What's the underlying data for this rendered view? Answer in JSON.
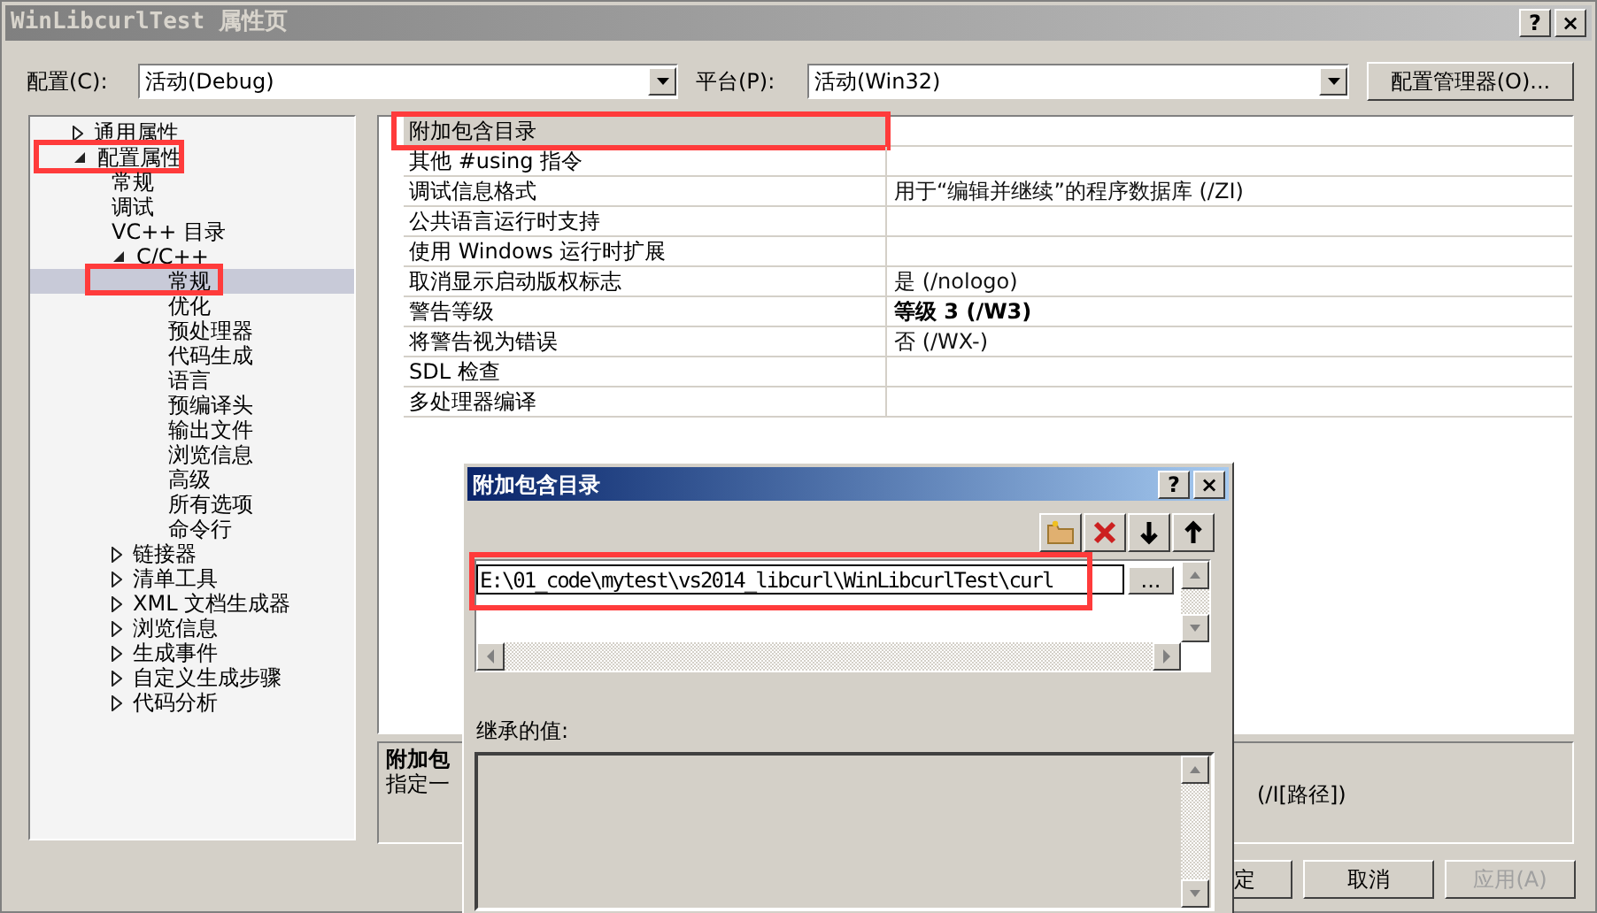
{
  "window": {
    "title": "WinLibcurlTest 属性页",
    "buttons": [
      "?",
      "×"
    ]
  },
  "config": {
    "label": "配置(C):",
    "value": "活动(Debug)"
  },
  "platform": {
    "label": "平台(P):",
    "value": "活动(Win32)"
  },
  "config_manager_button": "配置管理器(O)...",
  "tree": [
    {
      "label": "通用属性",
      "expanded": false,
      "selected": false,
      "highlighted": false
    },
    {
      "label": "配置属性",
      "expanded": true,
      "selected": false,
      "highlighted": true,
      "children": [
        {
          "label": "常规",
          "selected": false,
          "highlighted": false
        },
        {
          "label": "调试",
          "selected": false,
          "highlighted": false
        },
        {
          "label": "VC++ 目录",
          "selected": false,
          "highlighted": false
        },
        {
          "label": "C/C++",
          "expanded": true,
          "selected": false,
          "highlighted": false,
          "children": [
            {
              "label": "常规",
              "selected": true,
              "highlighted": true
            },
            {
              "label": "优化",
              "selected": false,
              "highlighted": false
            },
            {
              "label": "预处理器",
              "selected": false,
              "highlighted": false
            },
            {
              "label": "代码生成",
              "selected": false,
              "highlighted": false
            },
            {
              "label": "语言",
              "selected": false,
              "highlighted": false
            },
            {
              "label": "预编译头",
              "selected": false,
              "highlighted": false
            },
            {
              "label": "输出文件",
              "selected": false,
              "highlighted": false
            },
            {
              "label": "浏览信息",
              "selected": false,
              "highlighted": false
            },
            {
              "label": "高级",
              "selected": false,
              "highlighted": false
            },
            {
              "label": "所有选项",
              "selected": false,
              "highlighted": false
            },
            {
              "label": "命令行",
              "selected": false,
              "highlighted": false
            }
          ]
        },
        {
          "label": "链接器",
          "expanded": false,
          "selected": false,
          "highlighted": false
        },
        {
          "label": "清单工具",
          "expanded": false,
          "selected": false,
          "highlighted": false
        },
        {
          "label": "XML 文档生成器",
          "expanded": false,
          "selected": false,
          "highlighted": false
        },
        {
          "label": "浏览信息",
          "expanded": false,
          "selected": false,
          "highlighted": false
        },
        {
          "label": "生成事件",
          "expanded": false,
          "selected": false,
          "highlighted": false
        },
        {
          "label": "自定义生成步骤",
          "expanded": false,
          "selected": false,
          "highlighted": false
        },
        {
          "label": "代码分析",
          "expanded": false,
          "selected": false,
          "highlighted": false
        }
      ]
    }
  ],
  "properties": [
    {
      "name": "附加包含目录",
      "selected": true,
      "highlighted": true
    },
    {
      "name": "其他 #using 指令",
      "selected": false,
      "highlighted": false
    },
    {
      "name": "调试信息格式",
      "value": "用于“编辑并继续”的程序数据库 (/ZI)",
      "selected": false,
      "highlighted": false,
      "modified": false
    },
    {
      "name": "公共语言运行时支持",
      "selected": false,
      "highlighted": false
    },
    {
      "name": "使用 Windows 运行时扩展",
      "selected": false,
      "highlighted": false
    },
    {
      "name": "取消显示启动版权标志",
      "value": "是 (/nologo)",
      "selected": false,
      "highlighted": false,
      "modified": false
    },
    {
      "name": "警告等级",
      "value": "等级 3 (/W3)",
      "selected": false,
      "highlighted": false,
      "modified": true
    },
    {
      "name": "将警告视为错误",
      "value": "否 (/WX-)",
      "selected": false,
      "highlighted": false,
      "modified": false
    },
    {
      "name": "SDL 检查",
      "selected": false,
      "highlighted": false
    },
    {
      "name": "多处理器编译",
      "selected": false,
      "highlighted": false
    }
  ],
  "description": {
    "title": "附加包",
    "text": "指定一",
    "switch": "(/I[路径])"
  },
  "buttons": [
    {
      "label": "定",
      "disabled": false
    },
    {
      "label": "取消",
      "disabled": false
    },
    {
      "label": "应用(A)",
      "disabled": true
    }
  ],
  "dialog": {
    "title": "附加包含目录",
    "buttons": [
      "?",
      "×"
    ],
    "entries": [
      {
        "value": "E:\\01_code\\mytest\\vs2014_libcurl\\WinLibcurlTest\\curl",
        "highlighted": true
      }
    ],
    "browse_button": "...",
    "inherited_label": "继承的值:"
  }
}
